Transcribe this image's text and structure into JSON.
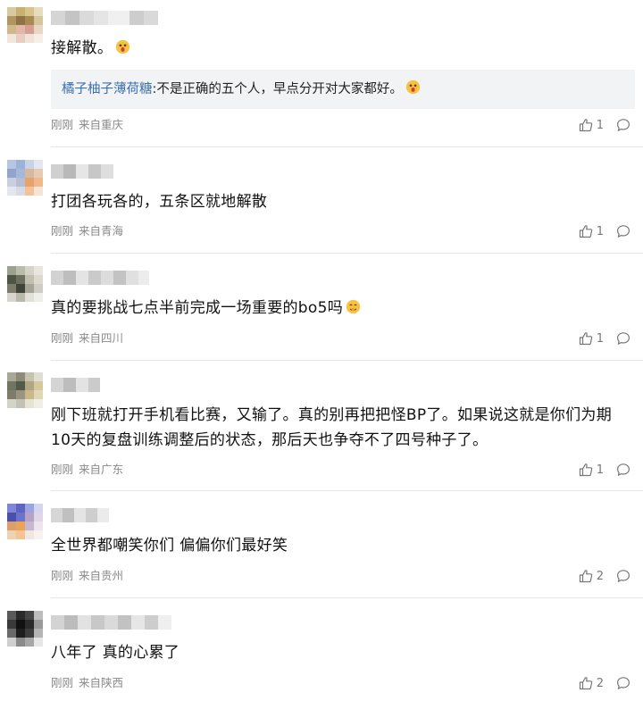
{
  "comments": [
    {
      "text": "接解散。",
      "emoji": "surprised-face-emoji",
      "quote": {
        "user": "橘子柚子薄荷糖",
        "sep": ":",
        "text": "不是正确的五个人，早点分开对大家都好。",
        "emoji": "surprised-face-emoji"
      },
      "time": "刚刚",
      "location": "来自重庆",
      "likes": "1"
    },
    {
      "text": "打团各玩各的，五条区就地解散",
      "time": "刚刚",
      "location": "来自青海",
      "likes": "1"
    },
    {
      "text": "真的要挑战七点半前完成一场重要的bo5吗",
      "emoji": "shush-face-emoji",
      "time": "刚刚",
      "location": "来自四川",
      "likes": "1"
    },
    {
      "text": "刚下班就打开手机看比赛，又输了。真的别再把把怪BP了。如果说这就是你们为期10天的复盘训练调整后的状态，那后天也争夺不了四号种子了。",
      "time": "刚刚",
      "location": "来自广东",
      "likes": "1"
    },
    {
      "text": "全世界都嘲笑你们 偏偏你们最好笑",
      "time": "刚刚",
      "location": "来自贵州",
      "likes": "2"
    },
    {
      "text": "八年了 真的心累了",
      "time": "刚刚",
      "location": "来自陕西",
      "likes": "2"
    }
  ],
  "colors": {
    "divider": "#e6e6e6",
    "meta": "#8a8a8a",
    "quote_user": "#3a6fb0",
    "quote_bg": "#f2f3f5"
  }
}
